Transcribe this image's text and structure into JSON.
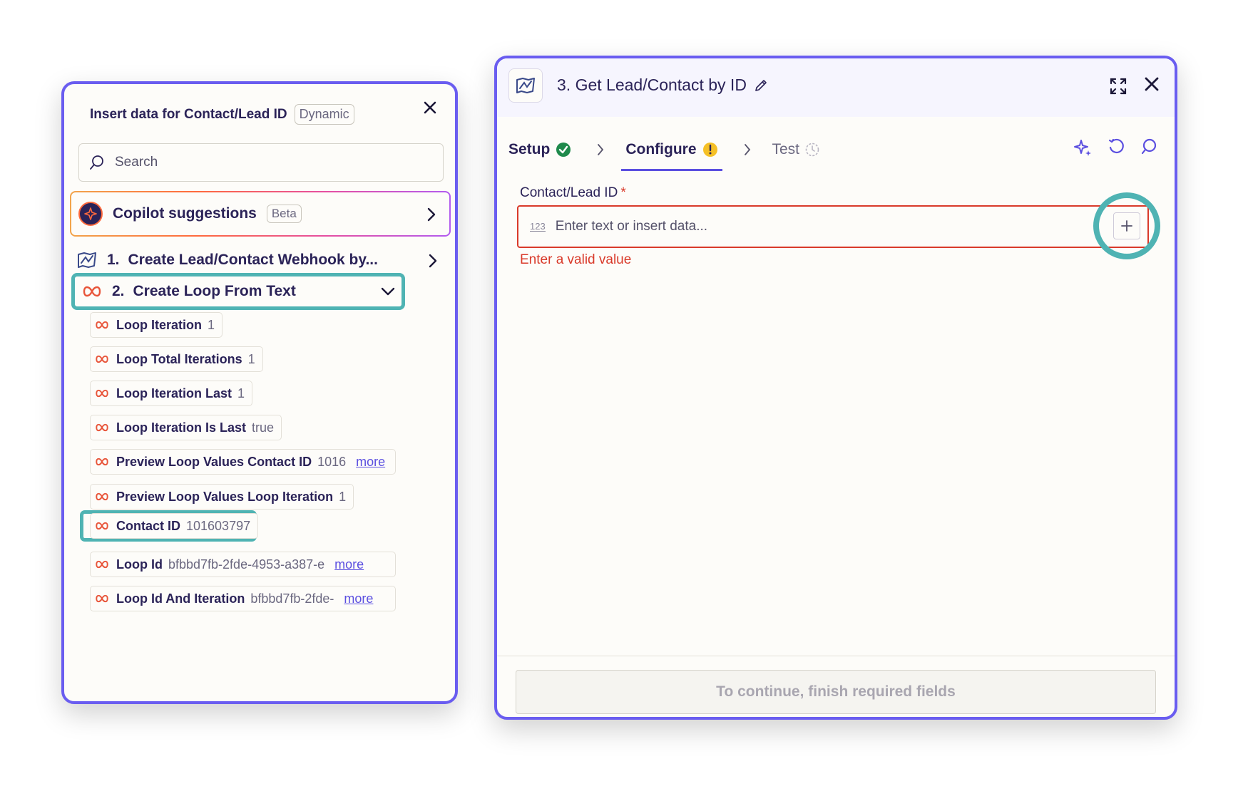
{
  "left_panel": {
    "title": "Insert data for Contact/Lead ID",
    "badge": "Dynamic",
    "search_placeholder": "Search",
    "copilot": {
      "label": "Copilot suggestions",
      "badge": "Beta"
    },
    "step1": {
      "number": "1.",
      "label": "Create Lead/Contact Webhook by..."
    },
    "step2": {
      "number": "2.",
      "label": "Create Loop From Text"
    },
    "items": [
      {
        "name": "Loop Iteration",
        "value": "1",
        "more": ""
      },
      {
        "name": "Loop Total Iterations",
        "value": "1",
        "more": ""
      },
      {
        "name": "Loop Iteration Last",
        "value": "1",
        "more": ""
      },
      {
        "name": "Loop Iteration Is Last",
        "value": "true",
        "more": ""
      },
      {
        "name": "Preview Loop Values Contact ID",
        "value": "1016",
        "more": "more"
      },
      {
        "name": "Preview Loop Values Loop Iteration",
        "value": "1",
        "more": ""
      },
      {
        "name": "Contact ID",
        "value": "101603797",
        "more": ""
      },
      {
        "name": "Loop Id",
        "value": "bfbbd7fb-2fde-4953-a387-e",
        "more": "more"
      },
      {
        "name": "Loop Id And Iteration",
        "value": "bfbbd7fb-2fde-",
        "more": "more"
      }
    ]
  },
  "right_panel": {
    "title": "3. Get Lead/Contact by ID",
    "tabs": [
      {
        "label": "Setup",
        "status": "complete"
      },
      {
        "label": "Configure",
        "status": "warning"
      },
      {
        "label": "Test",
        "status": "pending"
      }
    ],
    "field": {
      "label": "Contact/Lead ID",
      "required_mark": "*",
      "type_hint": "123",
      "placeholder": "Enter text or insert data...",
      "error": "Enter a valid value"
    },
    "continue_label": "To continue, finish required fields"
  },
  "colors": {
    "panel_border": "#6a5df0",
    "highlight": "#4fb3b3",
    "error": "#d93a2a",
    "accent": "#5b4fe0",
    "loop_icon": "#e8553a",
    "success": "#1f8a4c",
    "warning": "#f5c026"
  }
}
